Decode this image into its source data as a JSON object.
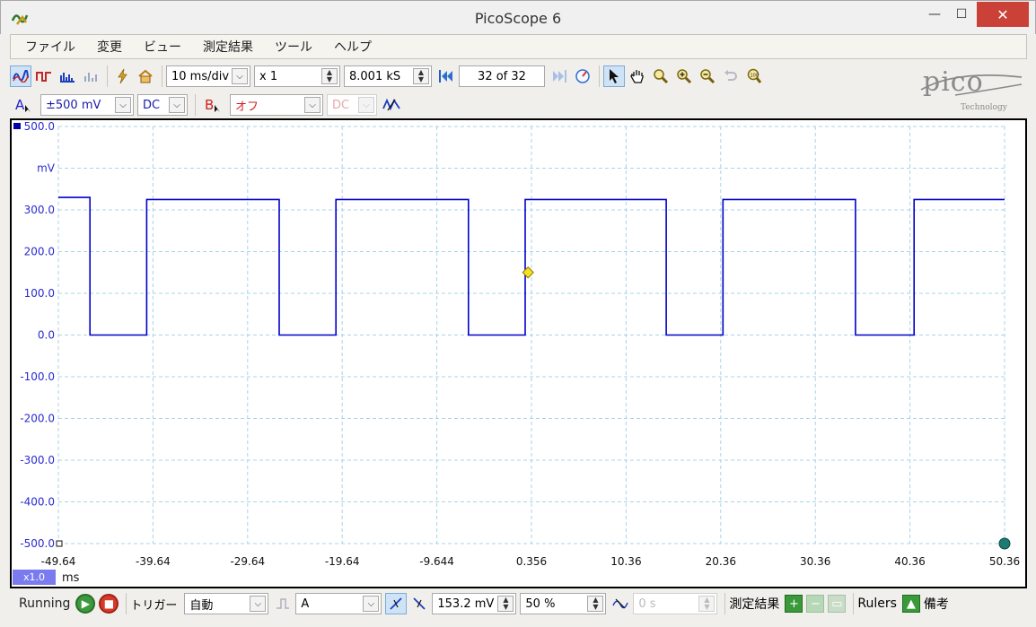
{
  "window": {
    "title": "PicoScope 6",
    "min_glyph": "—",
    "max_glyph": "☐",
    "close_glyph": "✕"
  },
  "menu": [
    "ファイル",
    "変更",
    "ビュー",
    "測定結果",
    "ツール",
    "ヘルプ"
  ],
  "toolbar": {
    "timebase": "10 ms/div",
    "zoom": "x 1",
    "samples": "8.001 kS",
    "buffer": "32 of 32"
  },
  "channels": {
    "a": {
      "label": "A",
      "range": "±500 mV",
      "coupling": "DC"
    },
    "b": {
      "label": "B",
      "range": "オフ",
      "coupling": "DC"
    }
  },
  "logo": {
    "word": "pico",
    "sub": "Technology"
  },
  "chart_data": {
    "type": "line",
    "ylabel": "mV",
    "ylim": [
      -500,
      500
    ],
    "xlim": [
      -49.64,
      50.36
    ],
    "y_ticks": [
      "500.0",
      "300.0",
      "200.0",
      "100.0",
      "0.0",
      "-100.0",
      "-200.0",
      "-300.0",
      "-400.0",
      "-500.0"
    ],
    "x_ticks": [
      "-49.64",
      "-39.64",
      "-29.64",
      "-19.64",
      "-9.644",
      "0.356",
      "10.36",
      "20.36",
      "30.36",
      "40.36",
      "50.36"
    ],
    "x_unit": "ms",
    "x_zoom_badge": "x1.0",
    "grid": true,
    "series": [
      {
        "color": "#0000cc",
        "x": [
          -49.64,
          -46.3,
          -46.3,
          -40.3,
          -40.3,
          -26.3,
          -26.3,
          -20.3,
          -20.3,
          -6.3,
          -6.3,
          -0.3,
          -0.3,
          14.6,
          14.6,
          20.6,
          20.6,
          34.6,
          34.6,
          40.8,
          40.8,
          50.36
        ],
        "y": [
          330,
          330,
          0,
          0,
          325,
          325,
          0,
          0,
          325,
          325,
          0,
          0,
          325,
          325,
          0,
          0,
          325,
          325,
          0,
          0,
          325,
          325
        ]
      }
    ],
    "trigger_marker": {
      "x": 0,
      "y": 150
    }
  },
  "status": {
    "running": "Running",
    "trigger_label": "トリガー",
    "trigger_mode": "自動",
    "trigger_channel": "A",
    "threshold": "153.2 mV",
    "pretrigger": "50 %",
    "delay": "0 s",
    "measurements": "測定結果",
    "rulers": "Rulers",
    "notes": "備考"
  }
}
